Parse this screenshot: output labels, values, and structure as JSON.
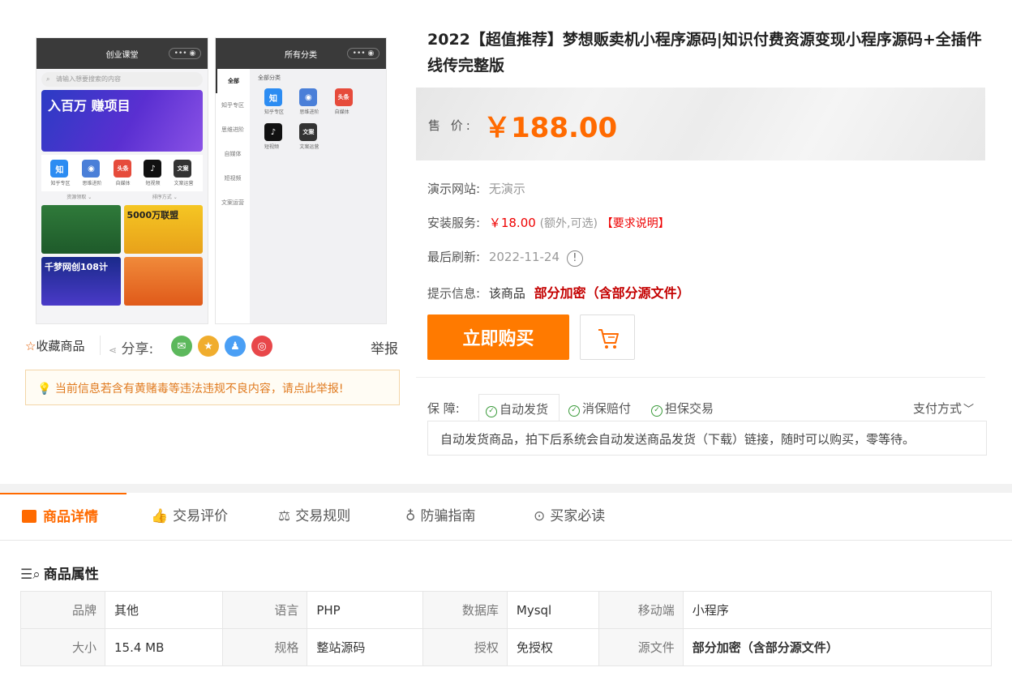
{
  "product": {
    "title": "2022【超值推荐】梦想贩卖机小程序源码|知识付费资源变现小程序源码+全插件线传完整版",
    "price_label": "售 价:",
    "price": "￥188.00"
  },
  "gallery": {
    "screen1": {
      "header": "创业课堂",
      "search_placeholder": "请输入想要搜索的内容",
      "banner_text": "入百万 赚项目",
      "icons": [
        {
          "glyph": "知",
          "label": "知乎专区",
          "color": "#2c8cf2"
        },
        {
          "glyph": "◉",
          "label": "思维进阶",
          "color": "#4a7fd8"
        },
        {
          "glyph": "头条",
          "label": "自媒体",
          "color": "#e64b3b"
        },
        {
          "glyph": "♪",
          "label": "短视频",
          "color": "#111111"
        },
        {
          "glyph": "文案",
          "label": "文案运营",
          "color": "#333333"
        }
      ],
      "sort_left": "资源领取 ⌄",
      "sort_right": "排序方式 ⌄",
      "cards": [
        "",
        "5000万联盟",
        "千梦网创108计",
        ""
      ]
    },
    "screen2": {
      "header": "所有分类",
      "sidebar": [
        "全部",
        "知乎专区",
        "思维进阶",
        "自媒体",
        "短视频",
        "文案运营"
      ],
      "section": "全部分类",
      "icons": [
        {
          "glyph": "知",
          "label": "知乎专区",
          "color": "#2c8cf2"
        },
        {
          "glyph": "◉",
          "label": "思维进阶",
          "color": "#4a7fd8"
        },
        {
          "glyph": "头条",
          "label": "自媒体",
          "color": "#e64b3b"
        },
        {
          "glyph": "♪",
          "label": "短视频",
          "color": "#111111"
        },
        {
          "glyph": "文案",
          "label": "文案运营",
          "color": "#333333"
        }
      ]
    }
  },
  "actions": {
    "favorite": "收藏商品",
    "share": "分享:",
    "report": "举报"
  },
  "warning": "当前信息若含有黄赌毒等违法违规不良内容，请点此举报!",
  "info": {
    "demo_label": "演示网站:",
    "demo_value": "无演示",
    "install_label": "安装服务:",
    "install_price": "￥18.00",
    "install_note": "(额外,可选)",
    "install_link": "【要求说明】",
    "refresh_label": "最后刷新:",
    "refresh_value": "2022-11-24",
    "tip_label": "提示信息:",
    "tip_prefix": "该商品",
    "tip_value": "部分加密（含部分源文件）"
  },
  "buttons": {
    "buy": "立即购买"
  },
  "guarantee": {
    "label": "保  障:",
    "items": [
      "自动发货",
      "消保赔付",
      "担保交易"
    ],
    "payment": "支付方式",
    "description": "自动发货商品，拍下后系统会自动发送商品发货（下载）链接，随时可以购买，零等待。"
  },
  "tabs": [
    "商品详情",
    "交易评价",
    "交易规则",
    "防骗指南",
    "买家必读"
  ],
  "attributes": {
    "title": "商品属性",
    "rows": [
      [
        [
          "品牌",
          "其他"
        ],
        [
          "语言",
          "PHP"
        ],
        [
          "数据库",
          "Mysql"
        ],
        [
          "移动端",
          "小程序"
        ]
      ],
      [
        [
          "大小",
          "15.4 MB"
        ],
        [
          "规格",
          "整站源码"
        ],
        [
          "授权",
          "免授权"
        ],
        [
          "源文件",
          "部分加密（含部分源文件）"
        ]
      ]
    ]
  },
  "colors": {
    "accent": "#ff6a00",
    "buy_button": "#ff7a00",
    "warning": "#e07a1f",
    "alert_red": "#c40000"
  }
}
